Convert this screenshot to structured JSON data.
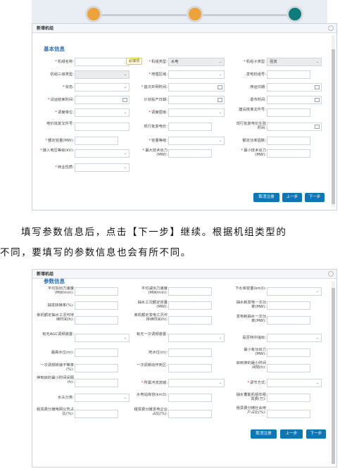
{
  "colors": {
    "accent": "#0a78b8",
    "step_orange": "#f0a23a",
    "step_teal": "#0f7b7b",
    "required": "#e02020"
  },
  "stepper": {
    "steps": [
      {
        "state": "done",
        "color": "#f0a23a"
      },
      {
        "state": "done",
        "color": "#f0a23a"
      },
      {
        "state": "current",
        "color": "#0f7b7b"
      }
    ]
  },
  "panel1": {
    "title": "新增机组",
    "section": "基本信息",
    "tooltip": "必填项",
    "fields": {
      "unit_name": {
        "label": "机组名称:",
        "value": ""
      },
      "unit_type": {
        "label": "机组类型:",
        "value": "水电"
      },
      "unit_subtype": {
        "label": "机组子类型:",
        "value": "径流"
      },
      "unit_level3": {
        "label": "机组三级类型:",
        "value": ""
      },
      "geo_region": {
        "label": "地理区域:",
        "value": ""
      },
      "gen_number": {
        "label": "发电机组号:",
        "value": ""
      },
      "status": {
        "label": "状态:",
        "value": ""
      },
      "first_grid": {
        "label": "首次并网时间:",
        "value": ""
      },
      "shutdown_date": {
        "label": "停运日期:",
        "value": ""
      },
      "trial_end": {
        "label": "试运结束时间:",
        "value": ""
      },
      "plan_prod": {
        "label": "计划投产日期:",
        "value": ""
      },
      "retire_time": {
        "label": "退市时间:",
        "value": ""
      },
      "dispatch_unit": {
        "label": "调度单位:",
        "value": ""
      },
      "dispatch_level": {
        "label": "调度层级:",
        "value": ""
      },
      "approval_doc": {
        "label": "建设核准文件号:",
        "value": ""
      },
      "price_doc": {
        "label": "电价批复文件号:",
        "value": ""
      },
      "current_price": {
        "label": "现行批复电价:",
        "value": ""
      },
      "price_effective": {
        "label": "现行批复电价生效时间:",
        "value": ""
      },
      "rated_capacity": {
        "label": "额定容量(MW):",
        "value": ""
      },
      "capacity_level": {
        "label": "容量等级:",
        "value": ""
      },
      "rated_pf": {
        "label": "额定功率因数:",
        "value": ""
      },
      "voltage_level": {
        "label": "接入电压等级(kV):",
        "value": ""
      },
      "max_output": {
        "label": "最大技术出力(MW):",
        "value": ""
      },
      "min_output": {
        "label": "最小技术出力(MW):",
        "value": ""
      },
      "commercial": {
        "label": "商业性质:",
        "value": ""
      }
    },
    "buttons": {
      "cancel": "取消注册",
      "prev": "上一步",
      "next": "下一步"
    }
  },
  "paragraph": {
    "line1": "填写参数信息后，点击【下一步】继续。根据机组类型的",
    "line2": "不同，要填写的参数信息也会有所不同。"
  },
  "panel2": {
    "title": "新增机组",
    "section": "参数信息",
    "fields": {
      "avg_up_rate": {
        "label": "平均加出力速度(MW/min):",
        "value": ""
      },
      "avg_down_rate": {
        "label": "平均减出力速度(MW/min):",
        "value": ""
      },
      "reservoir_cap": {
        "label": "下水库容量(km3):",
        "value": ""
      },
      "pump_eff": {
        "label": "抽发转换率(%):",
        "value": ""
      },
      "pump_rated_power": {
        "label": "抽水工况额定容量(MW):",
        "value": ""
      },
      "pump_once_power": {
        "label": "抽水耗发电一次功率(MW):",
        "value": ""
      },
      "single_pump_time": {
        "label": "单机额定抽水工况可持续时间(h):",
        "value": ""
      },
      "single_gen_time": {
        "label": "单机额定发电工况可持续时间(h):",
        "value": ""
      },
      "gen_once_power": {
        "label": "发电耗抽水一次功率(MW):",
        "value": ""
      },
      "agc": {
        "label": "有无AGC调频装置:",
        "value": ""
      },
      "primary_freq": {
        "label": "有无一次调频装置:",
        "value": ""
      },
      "black_start": {
        "label": "是否特许指标:",
        "value": ""
      },
      "max_water": {
        "label": "最高水位(m):",
        "value": ""
      },
      "dead_water": {
        "label": "死水位(m):",
        "value": ""
      },
      "min_reactive": {
        "label": "最小有功出力(MW):",
        "value": ""
      },
      "once_regulate": {
        "label": "一次调频转速不等率(%):",
        "value": ""
      },
      "once_regulate_zone": {
        "label": "一次调频动作死区:",
        "value": ""
      },
      "start_stop_interval": {
        "label": "启到停的最小时间间隔(h):",
        "value": ""
      },
      "stop_start_interval": {
        "label": "停到启的最小时间间隔(h):",
        "value": ""
      },
      "river_basin": {
        "label": "所属河流流域:",
        "value": ""
      },
      "regulation_mode": {
        "label": "调节方式:",
        "value": ""
      },
      "water_head": {
        "label": "水头分类:",
        "value": ""
      },
      "station_storage": {
        "label": "水电站库容(km3):",
        "value": ""
      },
      "pump_storage_fee": {
        "label": "抽水蓄能机组年租赁费(万):",
        "value": ""
      },
      "lease_share_grid": {
        "label": "租赁费分摊电网公司占比(%):",
        "value": ""
      },
      "lease_share_gen": {
        "label": "租赁费分摊发电企业占比(%):",
        "value": ""
      },
      "lease_share_user": {
        "label": "租赁费分摊社会用户占比(%):",
        "value": ""
      }
    },
    "buttons": {
      "cancel": "取消注册",
      "prev": "上一步",
      "next": "下一步"
    }
  }
}
